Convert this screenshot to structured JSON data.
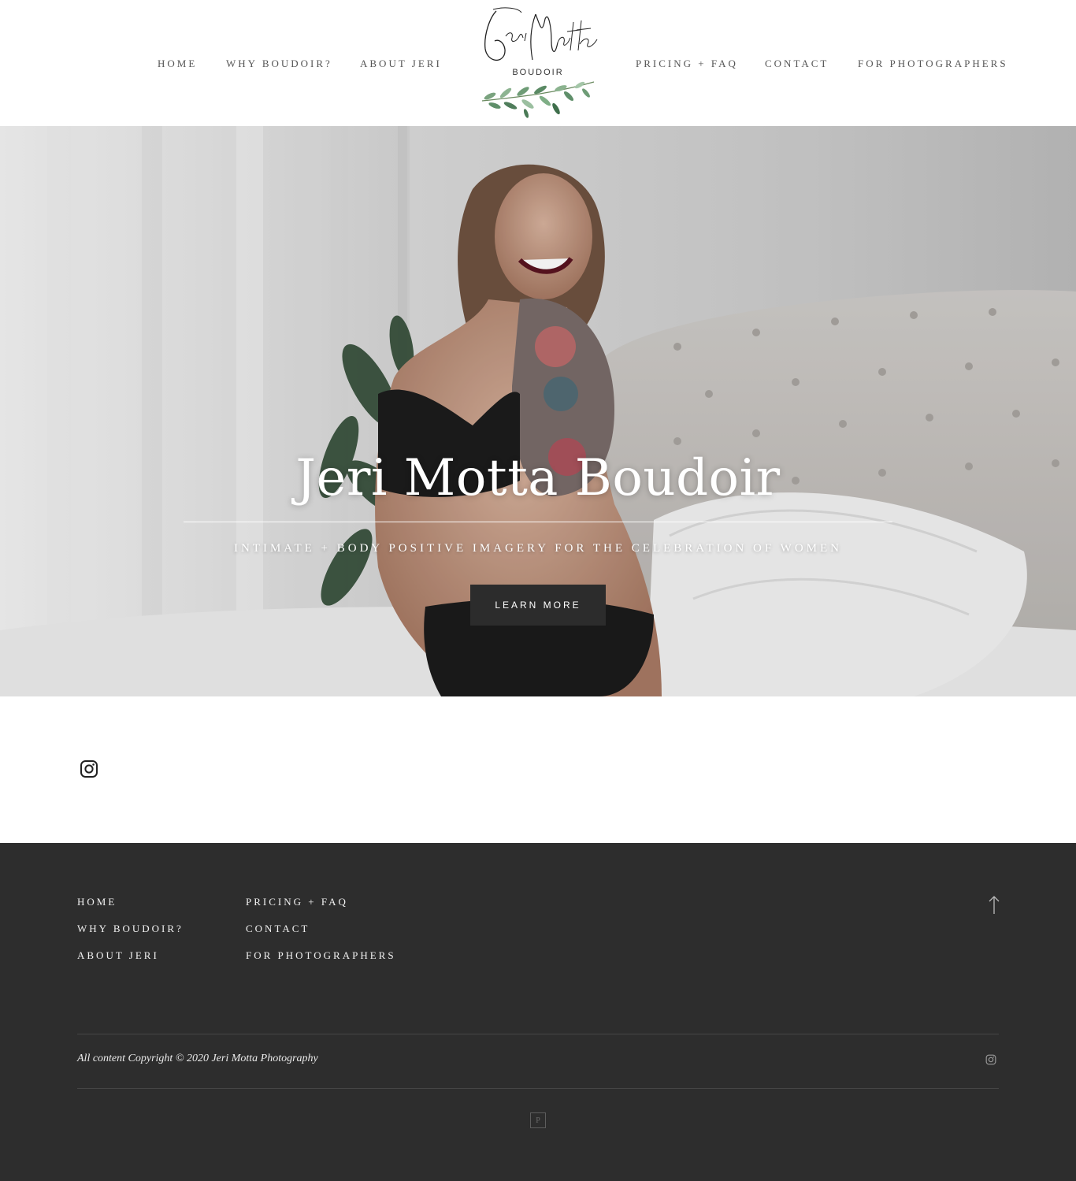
{
  "header": {
    "nav_left": [
      "HOME",
      "WHY BOUDOIR?",
      "ABOUT JERI"
    ],
    "nav_right": [
      "PRICING + FAQ",
      "CONTACT",
      "FOR PHOTOGRAPHERS"
    ],
    "logo": {
      "script_text": "Jeri Motta",
      "sub_text": "BOUDOIR",
      "icon": "olive-branch-icon"
    }
  },
  "hero": {
    "title": "Jeri Motta Boudoir",
    "subtitle": "INTIMATE + BODY POSITIVE IMAGERY FOR THE CELEBRATION OF WOMEN",
    "button_label": "LEARN MORE"
  },
  "instagram": {
    "icon": "instagram-icon"
  },
  "footer": {
    "col1": [
      "HOME",
      "WHY BOUDOIR?",
      "ABOUT JERI"
    ],
    "col2": [
      "PRICING + FAQ",
      "CONTACT",
      "FOR PHOTOGRAPHERS"
    ],
    "to_top_icon": "arrow-up-icon",
    "copyright": "All content Copyright © 2020 Jeri Motta Photography",
    "social_icon": "instagram-icon",
    "badge": "P"
  },
  "colors": {
    "footer_bg": "#2d2d2d",
    "button_bg": "#2c2c2c",
    "header_bg": "#ffffff",
    "nav_text": "#555555"
  }
}
